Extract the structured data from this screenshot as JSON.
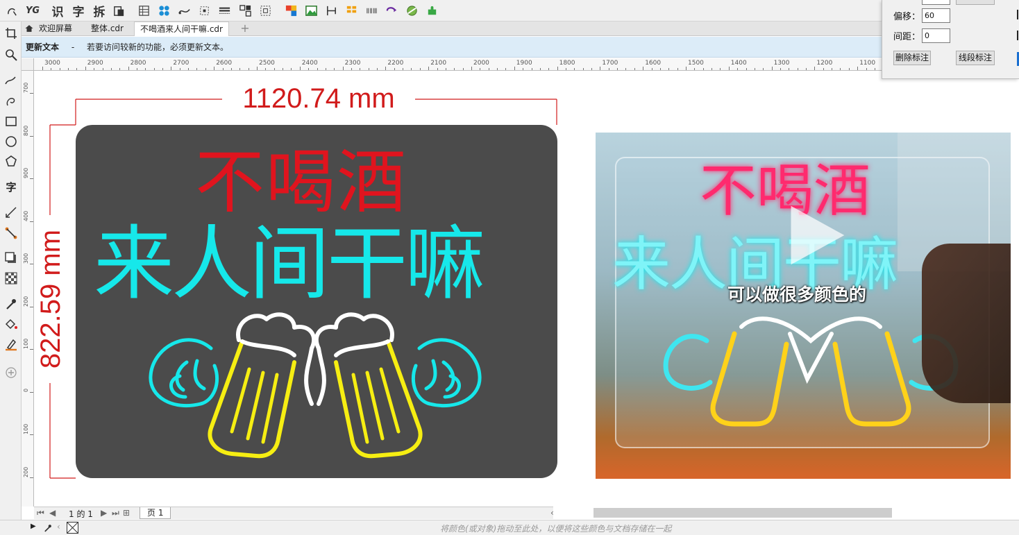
{
  "toolbar": {
    "btn_shi": "识",
    "btn_zi": "字",
    "btn_chai": "拆",
    "logo": "YG"
  },
  "tabs": [
    {
      "label": "欢迎屏幕"
    },
    {
      "label": "整体.cdr"
    },
    {
      "label": "不喝酒来人间干嘛.cdr"
    }
  ],
  "notice": {
    "title": "更新文本",
    "dash": "-",
    "message": "若要访问较新的功能，必须更新文本。"
  },
  "ruler": {
    "h": [
      "3000",
      "2900",
      "2800",
      "2700",
      "2600",
      "2500",
      "2400",
      "2300",
      "2200",
      "2100",
      "2000",
      "1900",
      "1800",
      "1700",
      "1600",
      "1500",
      "1400",
      "1300",
      "1200",
      "1100"
    ],
    "v": [
      "700",
      "800",
      "900",
      "400",
      "300",
      "200",
      "100",
      "0",
      "100",
      "200"
    ]
  },
  "toolbox": {
    "text_tool": "字"
  },
  "dimensions": {
    "width": "1120.74 mm",
    "height": "822.59 mm"
  },
  "design": {
    "line1": "不喝酒",
    "line2": "来人间干嘛"
  },
  "photo": {
    "caption": "可以做很多颜色的",
    "sign_line1": "不喝酒",
    "sign_line2": "来人间干嘛"
  },
  "panel": {
    "offset_label": "偏移：",
    "offset_value": "60",
    "spacing_label": "间距：",
    "spacing_value": "0",
    "delete_button": "删除标注",
    "segment_button": "线段标注"
  },
  "pagenav": {
    "page_count": "1 的 1",
    "page_tab": "页 1"
  },
  "status": {
    "hint": "将颜色(或对象)拖动至此处，以便将这些颜色与文档存储在一起"
  },
  "colors": {
    "red": "#e0141e",
    "cyan": "#16e8ea",
    "yellow": "#f6ee12",
    "white": "#ffffff",
    "board": "#4b4b4b",
    "dim": "#d11b1b"
  }
}
